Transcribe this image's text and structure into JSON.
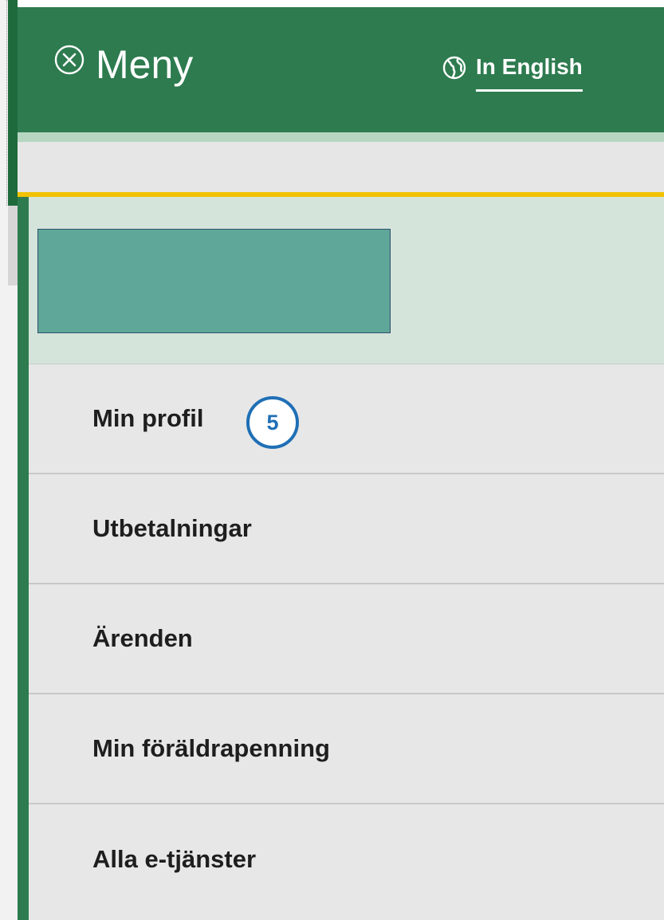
{
  "header": {
    "close_icon": "close-circle-icon",
    "title": "Meny",
    "language_link": {
      "icon": "globe-icon",
      "label": "In English"
    }
  },
  "user_panel": {
    "name_box_redacted": true
  },
  "nav": {
    "items": [
      {
        "label": "Min profil"
      },
      {
        "label": "Utbetalningar"
      },
      {
        "label": "Ärenden"
      },
      {
        "label": "Min föräldrapenning"
      },
      {
        "label": "Alla e-tjänster"
      }
    ]
  },
  "annotation": {
    "step_number": "5"
  },
  "colors": {
    "header_green": "#2d7b4f",
    "accent_yellow": "#f2c200",
    "user_panel_bg": "#d5e4da",
    "redaction_box": "#5fa798",
    "nav_bg": "#e7e7e7",
    "step_badge_blue": "#1f6fb5"
  }
}
